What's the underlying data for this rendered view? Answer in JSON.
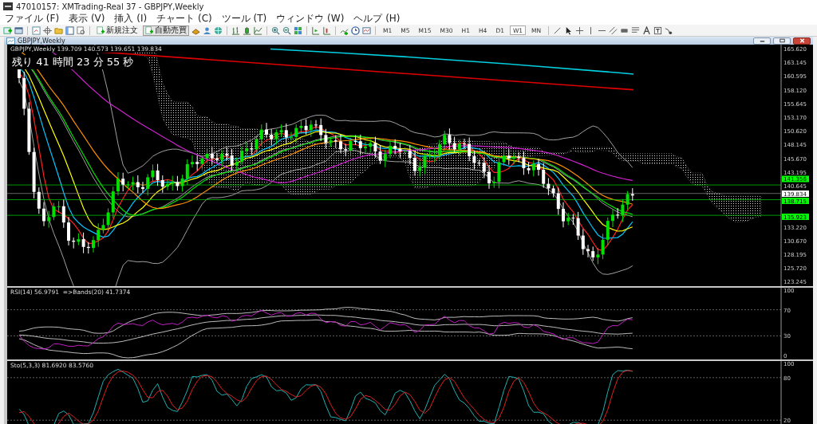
{
  "window": {
    "title": "47010157: XMTrading-Real 37 - GBPJPY,Weekly"
  },
  "menu": [
    "ファイル (F)",
    "表示 (V)",
    "挿入 (I)",
    "チャート (C)",
    "ツール (T)",
    "ウィンドウ (W)",
    "ヘルプ (H)"
  ],
  "toolbar": {
    "buttons": [
      {
        "label": "新規注文",
        "on": false
      },
      {
        "label": "自動売買",
        "on": true
      }
    ],
    "timeframes": [
      {
        "label": "M1",
        "selected": false
      },
      {
        "label": "M5",
        "selected": false
      },
      {
        "label": "M15",
        "selected": false
      },
      {
        "label": "M30",
        "selected": false
      },
      {
        "label": "H1",
        "selected": false
      },
      {
        "label": "H4",
        "selected": false
      },
      {
        "label": "D1",
        "selected": false
      },
      {
        "label": "W1",
        "selected": true
      },
      {
        "label": "MN",
        "selected": false
      }
    ]
  },
  "chart_window": {
    "title": "GBPJPY,Weekly",
    "header": "GBPJPY,Weekly  139.709 140.573 139.651 139.834",
    "countdown": "残り 41 時間 23 分 55 秒",
    "price_axis": [
      "165.620",
      "163.145",
      "160.595",
      "158.120",
      "155.645",
      "153.170",
      "150.620",
      "148.145",
      "145.670",
      "143.195",
      "140.645",
      "133.220",
      "130.670",
      "128.195",
      "125.720",
      "123.245"
    ],
    "price_tags": [
      {
        "text": "141.356",
        "color": "#00ff00"
      },
      {
        "text": "139.834",
        "color": "#ffffff"
      },
      {
        "text": "138.715",
        "color": "#00ff00"
      },
      {
        "text": "135.923",
        "color": "#00ff00"
      }
    ],
    "rsi": {
      "label": "RSI(14) 56.9791  =>Bands(20) 41.7374",
      "axis": [
        "100",
        "70",
        "30",
        "0"
      ]
    },
    "stochastic": {
      "label": "Sto(5,3,3) 81.6920 83.5760",
      "axis": [
        "100",
        "80",
        "20"
      ]
    }
  }
}
